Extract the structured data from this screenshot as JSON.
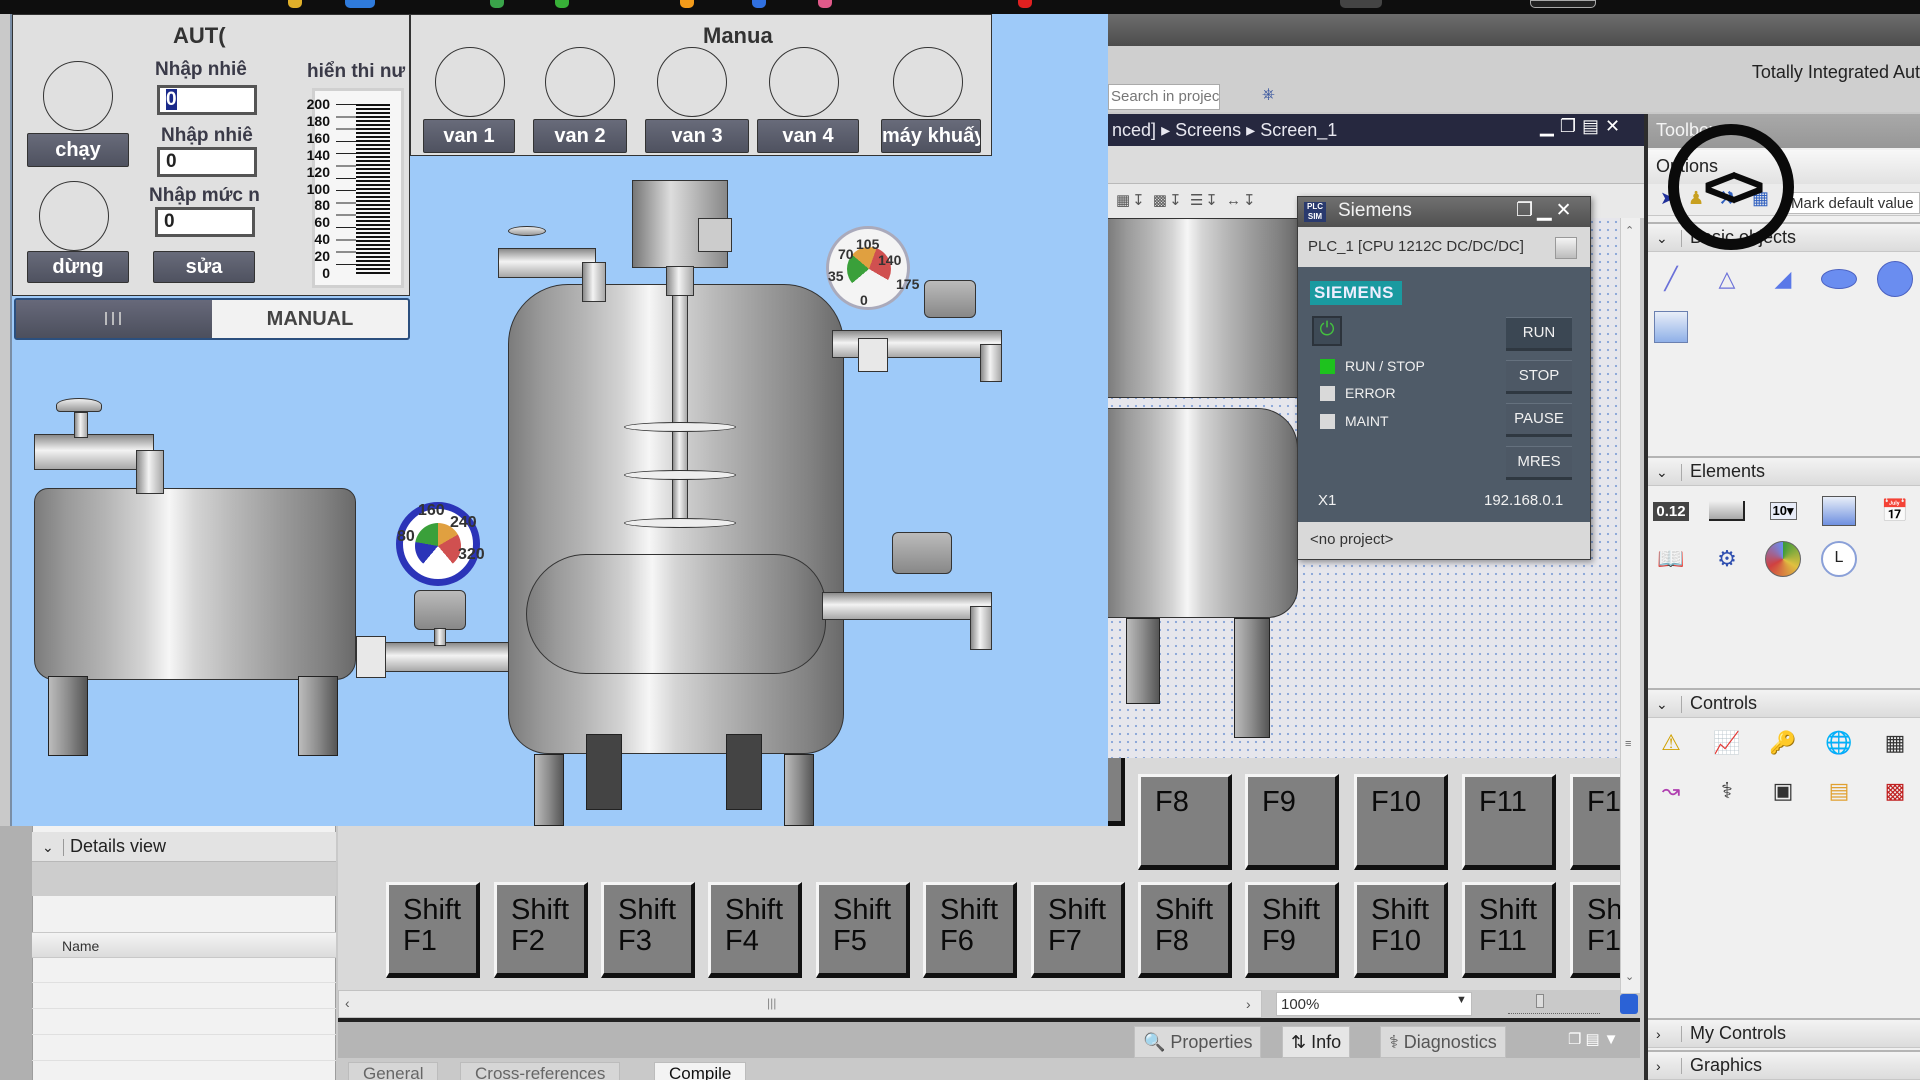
{
  "hmi": {
    "auto_panel": {
      "title": "AUT(",
      "start_button": "chạy",
      "stop_button": "dừng",
      "edit_button": "sửa",
      "temp_input_1_label": "Nhập nhiê",
      "temp_input_1_value": "0",
      "temp_input_2_label": "Nhập nhiê",
      "temp_input_2_value": "0",
      "level_input_label": "Nhập mức n",
      "level_input_value": "0",
      "display_label": "hiển thi nư",
      "bar_scale": [
        "200",
        "180",
        "160",
        "140",
        "120",
        "100",
        "80",
        "60",
        "40",
        "20",
        "0"
      ]
    },
    "mode_switch": {
      "auto_label": "III",
      "manual_label": "MANUAL"
    },
    "manual_panel": {
      "title": "Manua",
      "buttons": [
        "van 1",
        "van 2",
        "van 3",
        "van 4",
        "máy khuấy"
      ]
    },
    "gauge_left": {
      "labels": [
        "80",
        "160",
        "240",
        "320"
      ]
    },
    "gauge_right": {
      "labels": [
        "0",
        "35",
        "70",
        "105",
        "140",
        "175"
      ]
    }
  },
  "tia": {
    "title": "Totally Integrated Aut",
    "search_placeholder": "Search in project>",
    "breadcrumb": [
      "nced]",
      "Screens",
      "Screen_1"
    ],
    "fkeys_row1": [
      "",
      "",
      "",
      "",
      "",
      "",
      "",
      "F8",
      "F9",
      "F10",
      "F11",
      "F1"
    ],
    "fkeys_row2": [
      "Shift\nF1",
      "Shift\nF2",
      "Shift\nF3",
      "Shift\nF4",
      "Shift\nF5",
      "Shift\nF6",
      "Shift\nF7",
      "Shift\nF8",
      "Shift\nF9",
      "Shift\nF10",
      "Shift\nF11",
      "Sh\nF1"
    ],
    "zoom_value": "100%",
    "inspector_tabs": [
      "Properties",
      "Info",
      "Diagnostics"
    ],
    "sub_tabs": [
      "General",
      "Cross-references",
      "Compile"
    ],
    "details_view": {
      "title": "Details view",
      "column_name": "Name"
    },
    "toolbox": {
      "title": "Toolbox",
      "options_label": "Options",
      "mark_default": "Mark default value",
      "sections": {
        "basic": "Basic objects",
        "elements": "Elements",
        "controls": "Controls",
        "my_controls": "My Controls",
        "graphics": "Graphics"
      },
      "io_field_text": "0.12",
      "symbolic_io_text": "10"
    }
  },
  "plcsim": {
    "title": "Siemens",
    "cpu": "PLC_1 [CPU 1212C DC/DC/DC]",
    "brand": "SIEMENS",
    "leds": [
      {
        "label": "RUN / STOP",
        "color": "#1ec21e"
      },
      {
        "label": "ERROR",
        "color": "#d9d9d9"
      },
      {
        "label": "MAINT",
        "color": "#d9d9d9"
      }
    ],
    "buttons": [
      "RUN",
      "STOP",
      "PAUSE",
      "MRES"
    ],
    "interface": "X1",
    "ip": "192.168.0.1",
    "status": "<no project>"
  }
}
